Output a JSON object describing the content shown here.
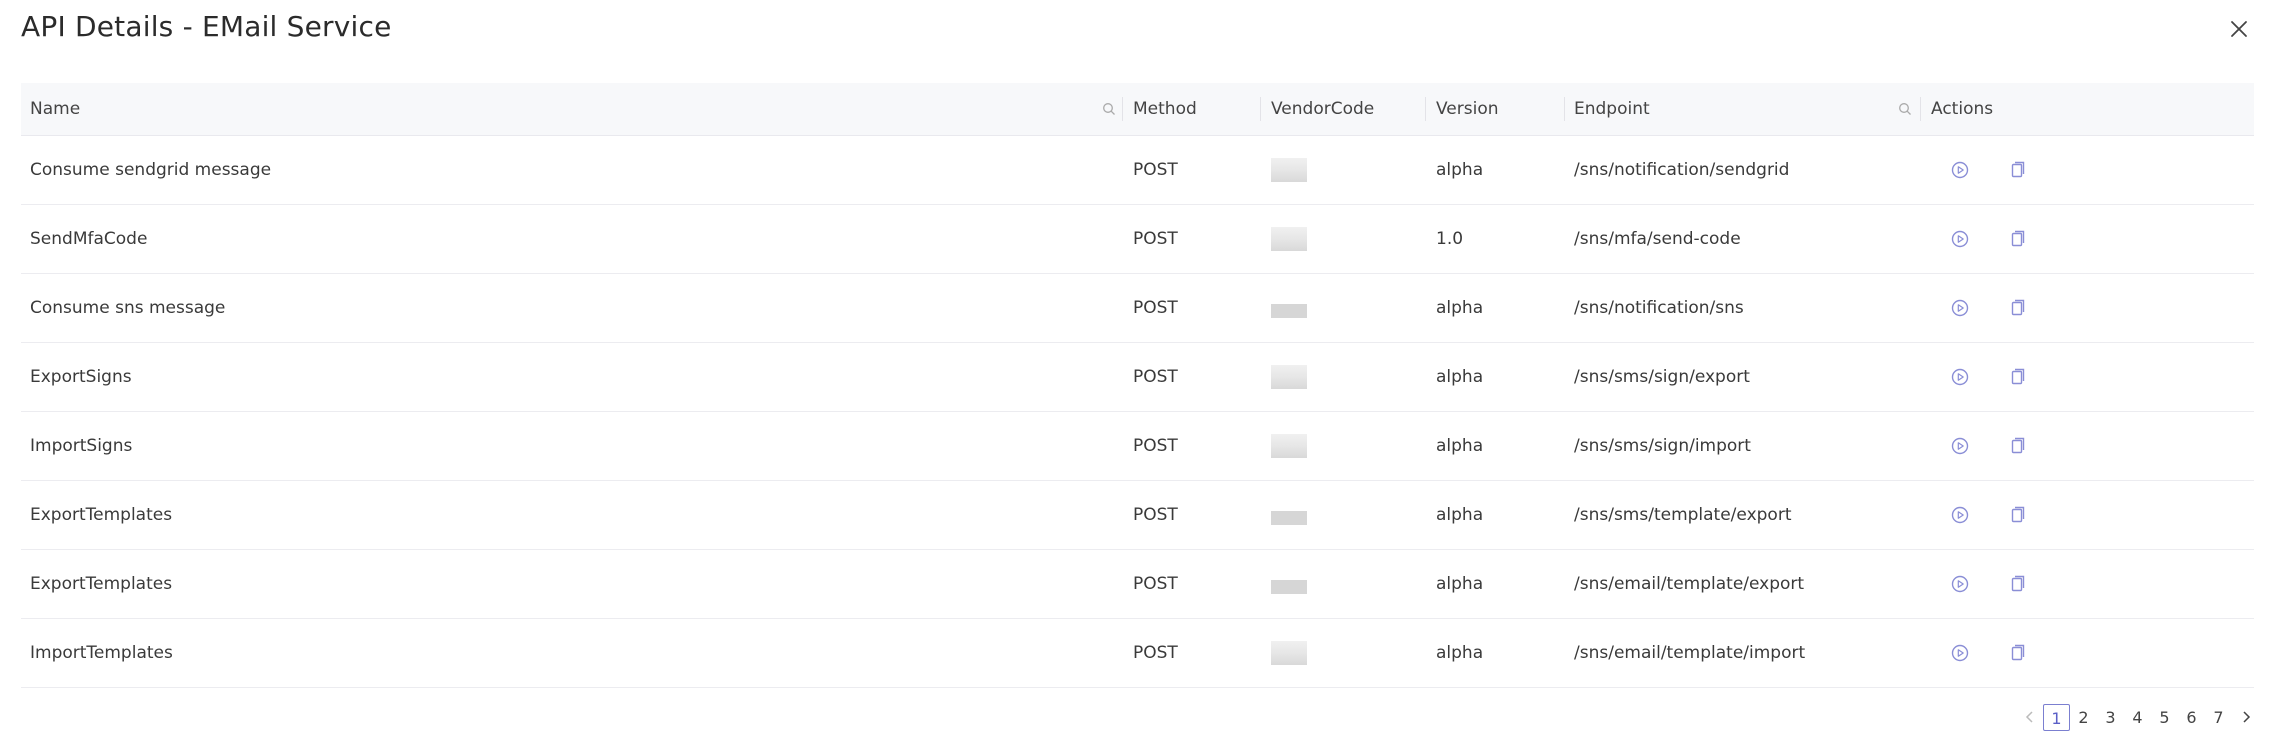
{
  "modal": {
    "title": "API Details - EMail Service",
    "close_icon": "close-icon"
  },
  "table": {
    "columns": {
      "name": "Name",
      "method": "Method",
      "vendor": "VendorCode",
      "version": "Version",
      "endpoint": "Endpoint",
      "actions": "Actions"
    },
    "rows": [
      {
        "name": "Consume sendgrid message",
        "method": "POST",
        "version": "alpha",
        "endpoint": "/sns/notification/sendgrid"
      },
      {
        "name": "SendMfaCode",
        "method": "POST",
        "version": "1.0",
        "endpoint": "/sns/mfa/send-code"
      },
      {
        "name": "Consume sns message",
        "method": "POST",
        "version": "alpha",
        "endpoint": "/sns/notification/sns"
      },
      {
        "name": "ExportSigns",
        "method": "POST",
        "version": "alpha",
        "endpoint": "/sns/sms/sign/export"
      },
      {
        "name": "ImportSigns",
        "method": "POST",
        "version": "alpha",
        "endpoint": "/sns/sms/sign/import"
      },
      {
        "name": "ExportTemplates",
        "method": "POST",
        "version": "alpha",
        "endpoint": "/sns/sms/template/export"
      },
      {
        "name": "ExportTemplates",
        "method": "POST",
        "version": "alpha",
        "endpoint": "/sns/email/template/export"
      },
      {
        "name": "ImportTemplates",
        "method": "POST",
        "version": "alpha",
        "endpoint": "/sns/email/template/import"
      }
    ]
  },
  "pagination": {
    "pages": [
      "1",
      "2",
      "3",
      "4",
      "5",
      "6",
      "7"
    ],
    "current": "1"
  },
  "colors": {
    "accent": "#7b7fd0",
    "header_bg": "#f7f8fa"
  },
  "icons": {
    "close": "close-icon",
    "column_search": "search-icon",
    "run": "play-circle-icon",
    "copy": "copy-icon",
    "prev": "chevron-left-icon",
    "next": "chevron-right-icon"
  }
}
